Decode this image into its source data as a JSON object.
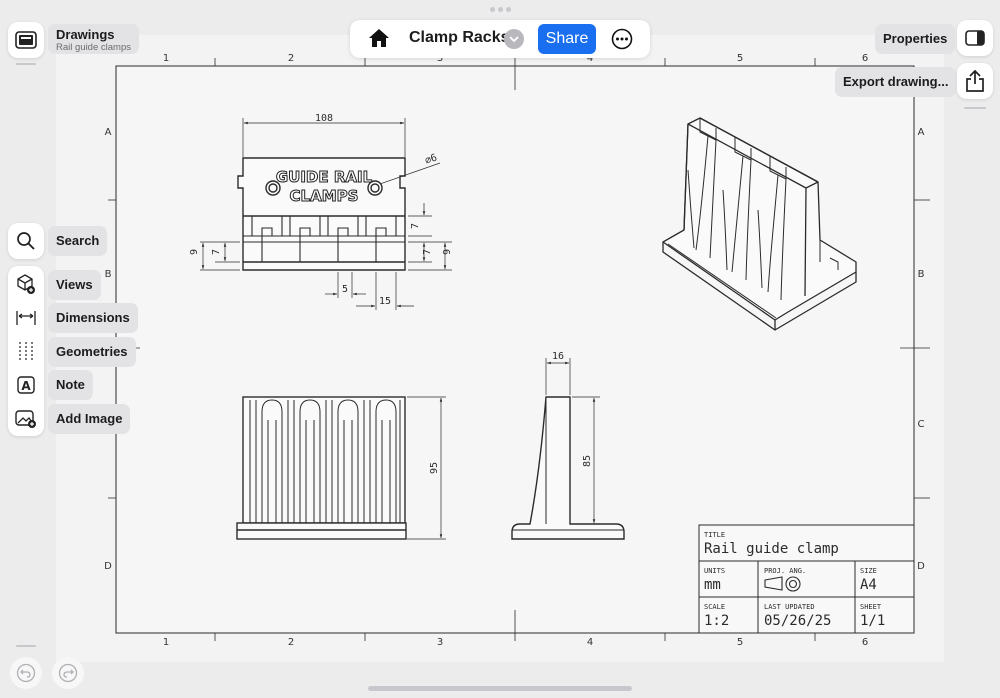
{
  "app": {
    "drawings_label": "Drawings",
    "drawings_sublabel": "Rail guide clamps"
  },
  "topbar": {
    "title": "Clamp Racks",
    "share_label": "Share"
  },
  "right_panel": {
    "properties_label": "Properties",
    "export_label": "Export drawing..."
  },
  "tools": {
    "search": "Search",
    "views": "Views",
    "dimensions": "Dimensions",
    "geometries": "Geometries",
    "note": "Note",
    "add_image": "Add Image"
  },
  "sheet": {
    "col_labels": [
      "1",
      "2",
      "3",
      "4",
      "5",
      "6"
    ],
    "row_labels": [
      "A",
      "B",
      "C",
      "D"
    ],
    "engraving_line1": "GUIDE RAIL",
    "engraving_line2": "CLAMPS",
    "dims": {
      "width_108": "108",
      "hole_dia": "⌀6",
      "d7a": "7",
      "d7b": "7",
      "d7c": "7",
      "d9a": "9",
      "d9b": "9",
      "d5": "5",
      "d15": "15",
      "d16": "16",
      "d95": "95",
      "d85": "85"
    }
  },
  "title_block": {
    "title_label": "TITLE",
    "title_value": "Rail guide clamp",
    "units_label": "UNITS",
    "units_value": "mm",
    "proj_label": "PROJ. ANG.",
    "size_label": "SIZE",
    "size_value": "A4",
    "scale_label": "SCALE",
    "scale_value": "1:2",
    "updated_label": "LAST UPDATED",
    "updated_value": "05/26/25",
    "sheet_label": "SHEET",
    "sheet_value": "1/1"
  },
  "colors": {
    "accent": "#1a6ff0",
    "line": "#2b2b2b",
    "sheet": "#f3f3f3"
  }
}
